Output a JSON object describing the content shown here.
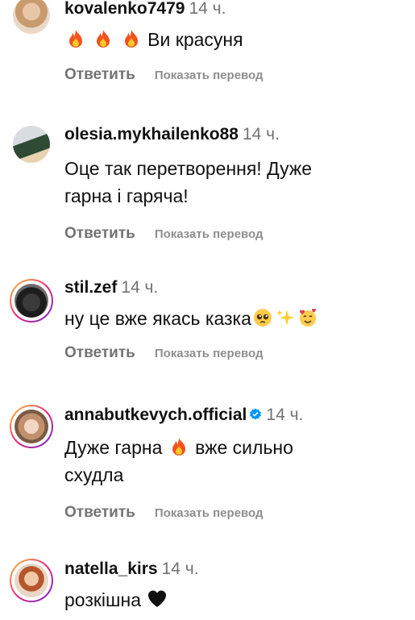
{
  "comments": [
    {
      "username": "kovalenko7479",
      "time": "14 ч.",
      "text": "Ви красуня",
      "emojis_before": [
        "fire-emoji",
        "fire-emoji",
        "fire-emoji"
      ],
      "reply_label": "Ответить",
      "translate_label": "Показать перевод"
    },
    {
      "username": "olesia.mykhailenko88",
      "time": "14 ч.",
      "text_line1": "Оце так перетворення! Дуже",
      "text_line2": "гарна і гаряча!",
      "reply_label": "Ответить",
      "translate_label": "Показать перевод"
    },
    {
      "username": "stil.zef",
      "time": "14 ч.",
      "text": "ну це вже якась казка",
      "emojis_after": [
        "pleading-face-emoji",
        "sparkles-emoji",
        "smiling-face-with-hearts-emoji"
      ],
      "reply_label": "Ответить",
      "translate_label": "Показать перевод"
    },
    {
      "username": "annabutkevych.official",
      "verified": true,
      "time": "14 ч.",
      "text_part1": "Дуже гарна",
      "text_part2": "вже сильно",
      "text_line2": "схудла",
      "emoji_mid": "fire-emoji",
      "reply_label": "Ответить",
      "translate_label": "Показать перевод"
    },
    {
      "username": "natella_kirs",
      "time": "14 ч.",
      "text": "розкішна",
      "emojis_after": [
        "black-heart-emoji"
      ]
    }
  ],
  "colors": {
    "secondary_text": "#737373",
    "verified_blue": "#0095f6",
    "story_ring": [
      "#f9ce34",
      "#ee2a7b",
      "#6228d7"
    ]
  }
}
